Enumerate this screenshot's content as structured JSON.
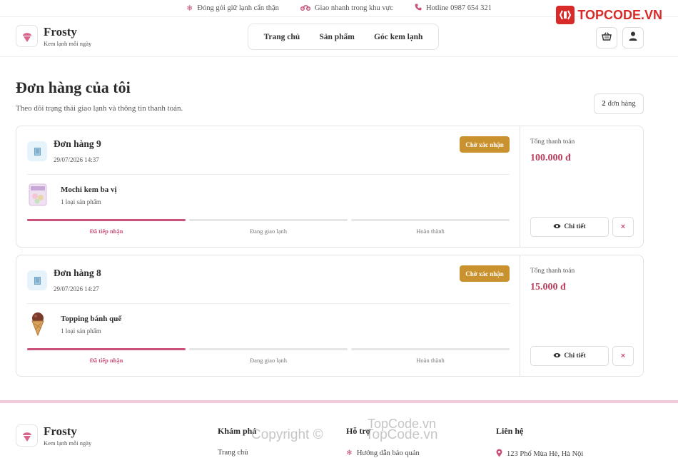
{
  "topbar": {
    "items": [
      {
        "icon": "snowflake-icon",
        "text": "Đóng gói giữ lạnh cẩn thận"
      },
      {
        "icon": "motorbike-icon",
        "text": "Giao nhanh trong khu vực"
      },
      {
        "icon": "phone-icon",
        "text": "Hotline 0987 654 321"
      }
    ]
  },
  "watermark_logo": "TOPCODE.VN",
  "brand": {
    "name": "Frosty",
    "tagline": "Kem lạnh mỗi ngày"
  },
  "nav": {
    "items": [
      "Trang chủ",
      "Sản phẩm",
      "Góc kem lạnh"
    ]
  },
  "header_actions": {
    "cart_icon": "basket-icon",
    "user_icon": "user-icon"
  },
  "page": {
    "title": "Đơn hàng của tôi",
    "subtitle": "Theo dõi trạng thái giao lạnh và thông tin thanh toán.",
    "count_number": "2",
    "count_text": "đơn hàng"
  },
  "orders": [
    {
      "title": "Đơn hàng 9",
      "date": "29/07/2026 14:37",
      "status": "Chờ xác nhận",
      "product_name": "Mochi kem ba vị",
      "product_qty": "1 loại sản phẩm",
      "steps": [
        "Đã tiếp nhận",
        "Đang giao lạnh",
        "Hoàn thành"
      ],
      "progress_step": 1,
      "total_label": "Tổng thanh toán",
      "total": "100.000 đ",
      "detail_label": "Chi tiết",
      "cancel_label": "×"
    },
    {
      "title": "Đơn hàng 8",
      "date": "29/07/2026 14:27",
      "status": "Chờ xác nhận",
      "product_name": "Topping bánh quế",
      "product_qty": "1 loại sản phẩm",
      "steps": [
        "Đã tiếp nhận",
        "Đang giao lạnh",
        "Hoàn thành"
      ],
      "progress_step": 1,
      "total_label": "Tổng thanh toán",
      "total": "15.000 đ",
      "detail_label": "Chi tiết",
      "cancel_label": "×"
    }
  ],
  "footer": {
    "brand_name": "Frosty",
    "brand_tagline": "Kem lạnh mỗi ngày",
    "col1_title": "Khám phá",
    "col1_link": "Trang chủ",
    "col2_title": "Hỗ trợ",
    "col2_link": "Hướng dẫn bảo quản",
    "col3_title": "Liên hệ",
    "col3_link": "123 Phố Mùa Hè, Hà Nội",
    "watermark_left": "Copyright ©",
    "watermark_right": "TopCode.vn",
    "watermark_top": "TopCode.vn"
  },
  "colors": {
    "accent": "#c8527a",
    "status": "#c9922f",
    "price": "#b8405e"
  }
}
